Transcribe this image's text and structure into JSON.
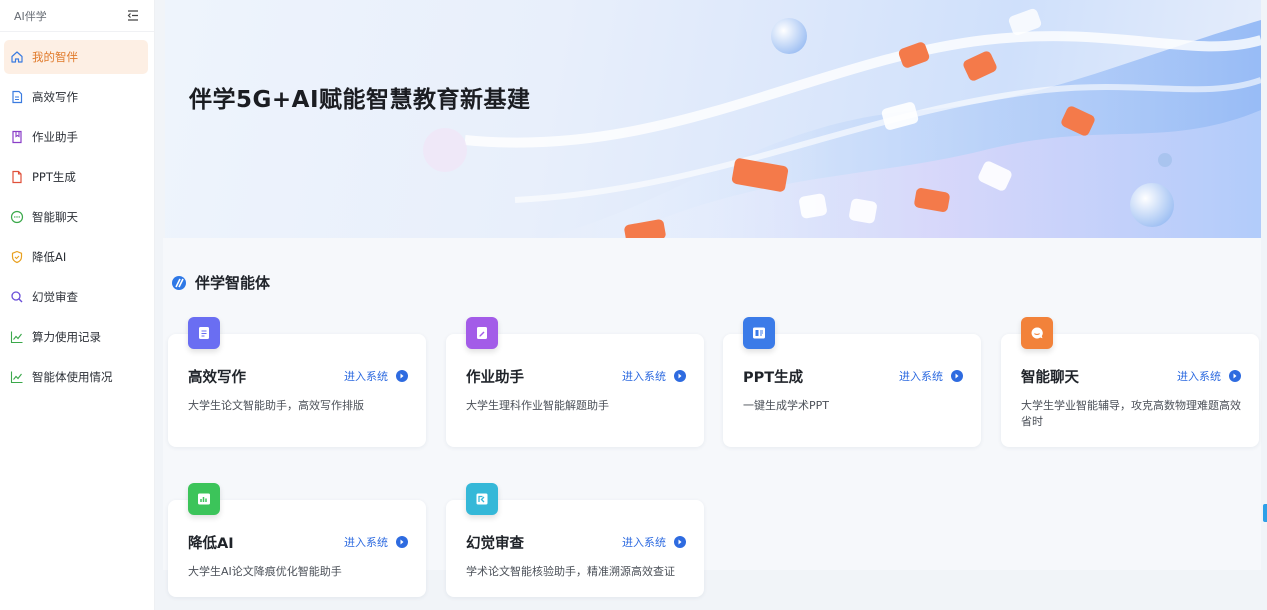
{
  "sidebar": {
    "title": "AI伴学",
    "items": [
      {
        "label": "我的智伴",
        "icon": "home-icon",
        "active": true
      },
      {
        "label": "高效写作",
        "icon": "document-icon",
        "active": false
      },
      {
        "label": "作业助手",
        "icon": "bookmark-icon",
        "active": false
      },
      {
        "label": "PPT生成",
        "icon": "file-icon",
        "active": false
      },
      {
        "label": "智能聊天",
        "icon": "chat-icon",
        "active": false
      },
      {
        "label": "降低AI",
        "icon": "shield-icon",
        "active": false
      },
      {
        "label": "幻觉审查",
        "icon": "search-icon",
        "active": false
      },
      {
        "label": "算力使用记录",
        "icon": "chart-line-icon",
        "active": false
      },
      {
        "label": "智能体使用情况",
        "icon": "chart-line-icon",
        "active": false
      }
    ]
  },
  "banner": {
    "title": "伴学5G+AI赋能智慧教育新基建"
  },
  "section": {
    "title": "伴学智能体"
  },
  "cards": [
    {
      "title": "高效写作",
      "enter": "进入系统",
      "desc": "大学生论文智能助手，高效写作排版",
      "color": "#6a6ef2",
      "icon": "document-icon"
    },
    {
      "title": "作业助手",
      "enter": "进入系统",
      "desc": "大学生理科作业智能解题助手",
      "color": "#a35ce8",
      "icon": "edit-icon"
    },
    {
      "title": "PPT生成",
      "enter": "进入系统",
      "desc": "一键生成学术PPT",
      "color": "#3b7be8",
      "icon": "presentation-icon"
    },
    {
      "title": "智能聊天",
      "enter": "进入系统",
      "desc": "大学生学业智能辅导，攻克高数物理难题高效省时",
      "color": "#f2823a",
      "icon": "chat-icon"
    },
    {
      "title": "降低AI",
      "enter": "进入系统",
      "desc": "大学生AI论文降痕优化智能助手",
      "color": "#3cc45a",
      "icon": "chart-bar-icon"
    },
    {
      "title": "幻觉审查",
      "enter": "进入系统",
      "desc": "学术论文智能核验助手，精准溯源高效查证",
      "color": "#35b8d8",
      "icon": "review-icon"
    }
  ],
  "colors": {
    "accent": "#e07a2b",
    "link": "#2e6be0"
  }
}
